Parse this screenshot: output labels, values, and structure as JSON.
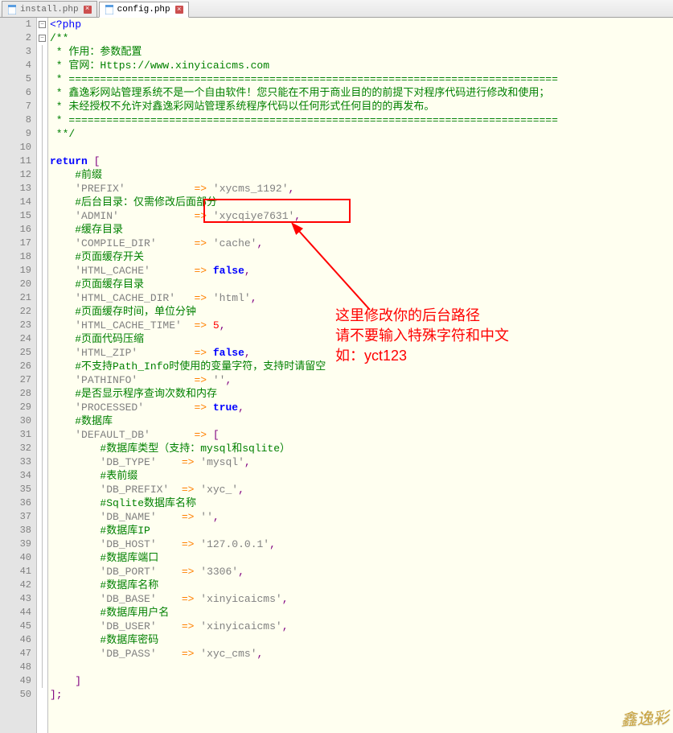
{
  "tabs": [
    {
      "label": "install.php",
      "active": false
    },
    {
      "label": "config.php",
      "active": true
    }
  ],
  "code": {
    "l1": "<?php",
    "l2": "/**",
    "l3": " * 作用：参数配置",
    "l4": " * 官网：Https://www.xinyicaicms.com",
    "l5": " * ==============================================================================",
    "l6": " * 鑫逸彩网站管理系统不是一个自由软件！您只能在不用于商业目的的前提下对程序代码进行修改和使用；",
    "l7": " * 未经授权不允许对鑫逸彩网站管理系统程序代码以任何形式任何目的的再发布。",
    "l8": " * ==============================================================================",
    "l9": " **/",
    "l11_kw": "return",
    "l12": "#前缀",
    "l13_k": "'PREFIX'",
    "l13_v": "'xycms_1192'",
    "l14": "#后台目录：仅需修改后面部分",
    "l15_k": "'ADMIN'",
    "l15_v": "'xycqiye7631'",
    "l16": "#缓存目录",
    "l17_k": "'COMPILE_DIR'",
    "l17_v": "'cache'",
    "l18": "#页面缓存开关",
    "l19_k": "'HTML_CACHE'",
    "l19_v": "false",
    "l20": "#页面缓存目录",
    "l21_k": "'HTML_CACHE_DIR'",
    "l21_v": "'html'",
    "l22": "#页面缓存时间，单位分钟",
    "l23_k": "'HTML_CACHE_TIME'",
    "l23_v": "5",
    "l24": "#页面代码压缩",
    "l25_k": "'HTML_ZIP'",
    "l25_v": "false",
    "l26": "#不支持Path_Info时使用的变量字符，支持时请留空",
    "l27_k": "'PATHINFO'",
    "l27_v": "''",
    "l28": "#是否显示程序查询次数和内存",
    "l29_k": "'PROCESSED'",
    "l29_v": "true",
    "l30": "#数据库",
    "l31_k": "'DEFAULT_DB'",
    "l32": "#数据库类型（支持：mysql和sqlite）",
    "l33_k": "'DB_TYPE'",
    "l33_v": "'mysql'",
    "l34": "#表前缀",
    "l35_k": "'DB_PREFIX'",
    "l35_v": "'xyc_'",
    "l36": "#Sqlite数据库名称",
    "l37_k": "'DB_NAME'",
    "l37_v": "''",
    "l38": "#数据库IP",
    "l39_k": "'DB_HOST'",
    "l39_v": "'127.0.0.1'",
    "l40": "#数据库端口",
    "l41_k": "'DB_PORT'",
    "l41_v": "'3306'",
    "l42": "#数据库名称",
    "l43_k": "'DB_BASE'",
    "l43_v": "'xinyicaicms'",
    "l44": "#数据库用户名",
    "l45_k": "'DB_USER'",
    "l45_v": "'xinyicaicms'",
    "l46": "#数据库密码",
    "l47_k": "'DB_PASS'",
    "l47_v": "'xyc_cms'"
  },
  "annotation": {
    "line1": "这里修改你的后台路径",
    "line2": "请不要输入特殊字符和中文",
    "line3": "如：yct123"
  },
  "watermark": "鑫逸彩",
  "line_count": 50
}
